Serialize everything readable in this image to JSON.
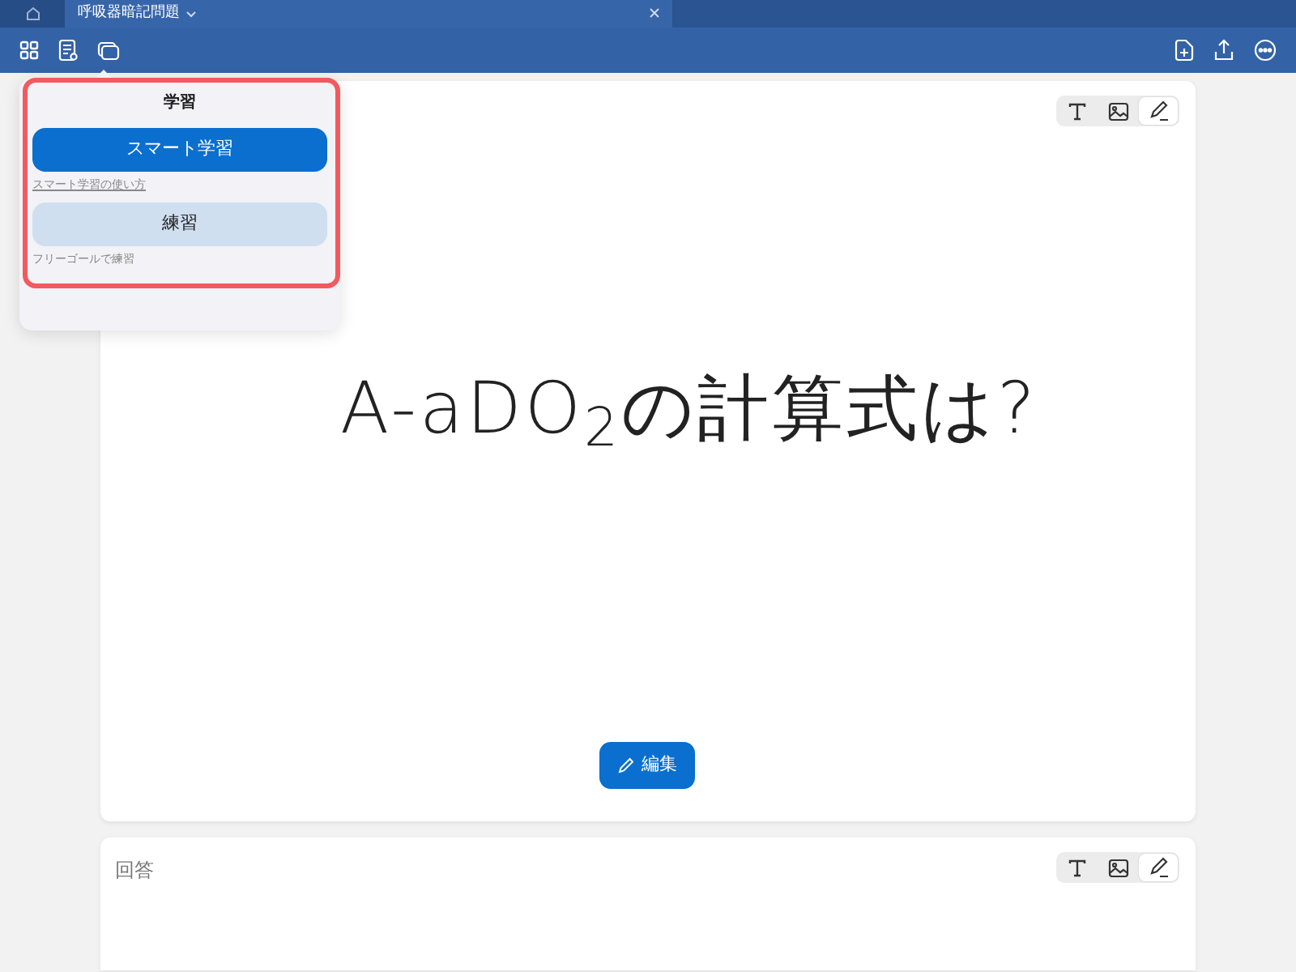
{
  "tab_bar": {
    "tabs": [
      {
        "kind": "home",
        "selected": false
      },
      {
        "kind": "document",
        "label": "呼吸器暗記問題",
        "selected": true
      }
    ]
  },
  "popover": {
    "title": "学習",
    "highlighted": true,
    "options": [
      {
        "kind": "primary",
        "label": "スマート学習",
        "caption": "スマート学習の使い方",
        "caption_link": true
      },
      {
        "kind": "secondary",
        "label": "練習",
        "caption": "フリーゴールで練習",
        "caption_link": false
      }
    ]
  },
  "question_card": {
    "tools": [
      {
        "kind": "text",
        "selected": false
      },
      {
        "kind": "image",
        "selected": false
      },
      {
        "kind": "pen",
        "selected": true
      }
    ],
    "handwriting": "A-aDO$_{2}$の計算式は?",
    "edit_button": "編集"
  },
  "answer_card": {
    "label": "回答",
    "tools": [
      {
        "kind": "text",
        "selected": false
      },
      {
        "kind": "image",
        "selected": false
      },
      {
        "kind": "pen",
        "selected": true
      }
    ]
  }
}
